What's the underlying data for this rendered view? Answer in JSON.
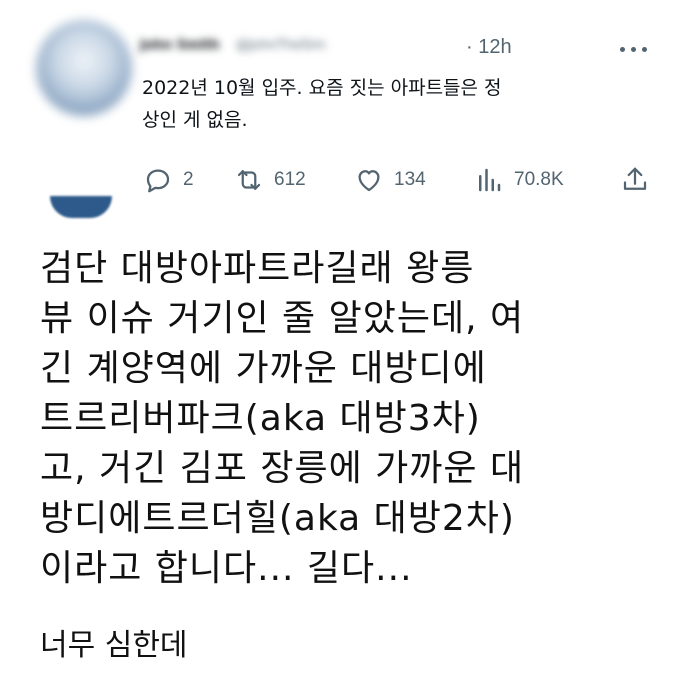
{
  "tweet": {
    "author_name": "John Smith",
    "author_handle": "@JohnTheSim",
    "timestamp": "· 12h",
    "text_line1": "2022년 10월 입주. 요즘 짓는 아파트들은 정",
    "text_line2": "상인 게 없음.",
    "stats": {
      "replies": "2",
      "retweets": "612",
      "likes": "134",
      "views": "70.8K"
    },
    "icons": [
      "reply-icon",
      "retweet-icon",
      "like-icon",
      "views-icon",
      "share-icon",
      "more-icon"
    ]
  },
  "comment": {
    "lines": [
      "검단 대방아파트라길래 왕릉",
      "뷰 이슈 거기인 줄 알았는데, 여",
      "긴 계양역에 가까운 대방디에",
      "트르리버파크(aka 대방3차)",
      "고, 거긴 김포 장릉에 가까운 대",
      "방디에트르더힐(aka 대방2차)",
      "이라고 합니다... 길다..."
    ],
    "footer": "너무 심한데"
  },
  "colors": {
    "text_primary": "#0f1419",
    "text_secondary": "#536471",
    "body_text": "#111111"
  }
}
